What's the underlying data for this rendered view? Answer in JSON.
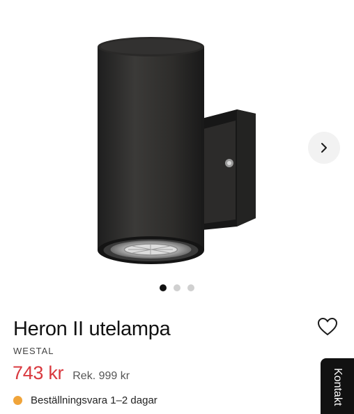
{
  "product": {
    "title": "Heron II utelampa",
    "brand": "WESTAL",
    "price": "743 kr",
    "recommended_price": "Rek. 999 kr",
    "stock_text": "Beställningsvara 1–2 dagar",
    "image_name": "black-wall-lamp-image"
  },
  "gallery": {
    "active_index": 0,
    "dot_count": 3,
    "next_icon": "chevron-right-icon"
  },
  "icons": {
    "wishlist": "heart-outline-icon"
  },
  "contact": {
    "label": "Kontakt"
  },
  "colors": {
    "price": "#d9393f",
    "stock_dot": "#f0a43a",
    "active_dot": "#111111",
    "inactive_dot": "#d0d0d0"
  }
}
